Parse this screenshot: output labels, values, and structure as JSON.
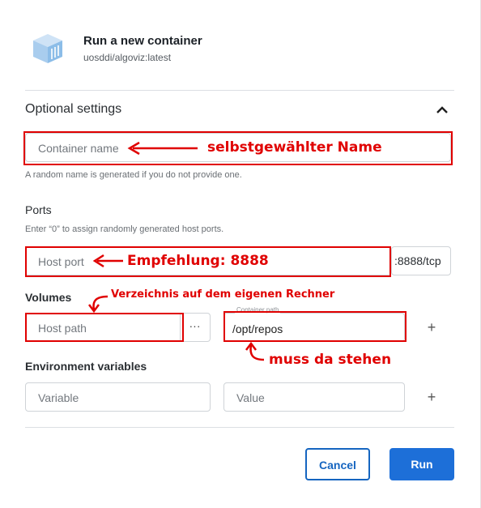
{
  "header": {
    "title": "Run a new container",
    "subtitle": "uosddi/algoviz:latest",
    "icon": "container-cube-icon"
  },
  "optional": {
    "section_title": "Optional settings",
    "container_name_placeholder": "Container name",
    "container_name_helper": "A random name is generated if you do not provide one."
  },
  "ports": {
    "label": "Ports",
    "helper": "Enter “0” to assign randomly generated host ports.",
    "host_port_placeholder": "Host port",
    "container_port": ":8888/tcp"
  },
  "volumes": {
    "label": "Volumes",
    "host_path_placeholder": "Host path",
    "browse_label": "···",
    "container_path_label": "Container path",
    "container_path_value": "/opt/repos",
    "add_label": "+"
  },
  "env": {
    "label": "Environment variables",
    "variable_placeholder": "Variable",
    "value_placeholder": "Value",
    "add_label": "+"
  },
  "buttons": {
    "cancel": "Cancel",
    "run": "Run"
  },
  "annotations": {
    "name_note": "selbstgewählter Name",
    "port_note": "Empfehlung: 8888",
    "volume_note": "Verzeichnis auf dem eigenen Rechner",
    "path_note": "muss da stehen"
  },
  "colors": {
    "accent": "#1d6fd8",
    "annotation": "#e00000",
    "icon": "#a9cdee"
  }
}
